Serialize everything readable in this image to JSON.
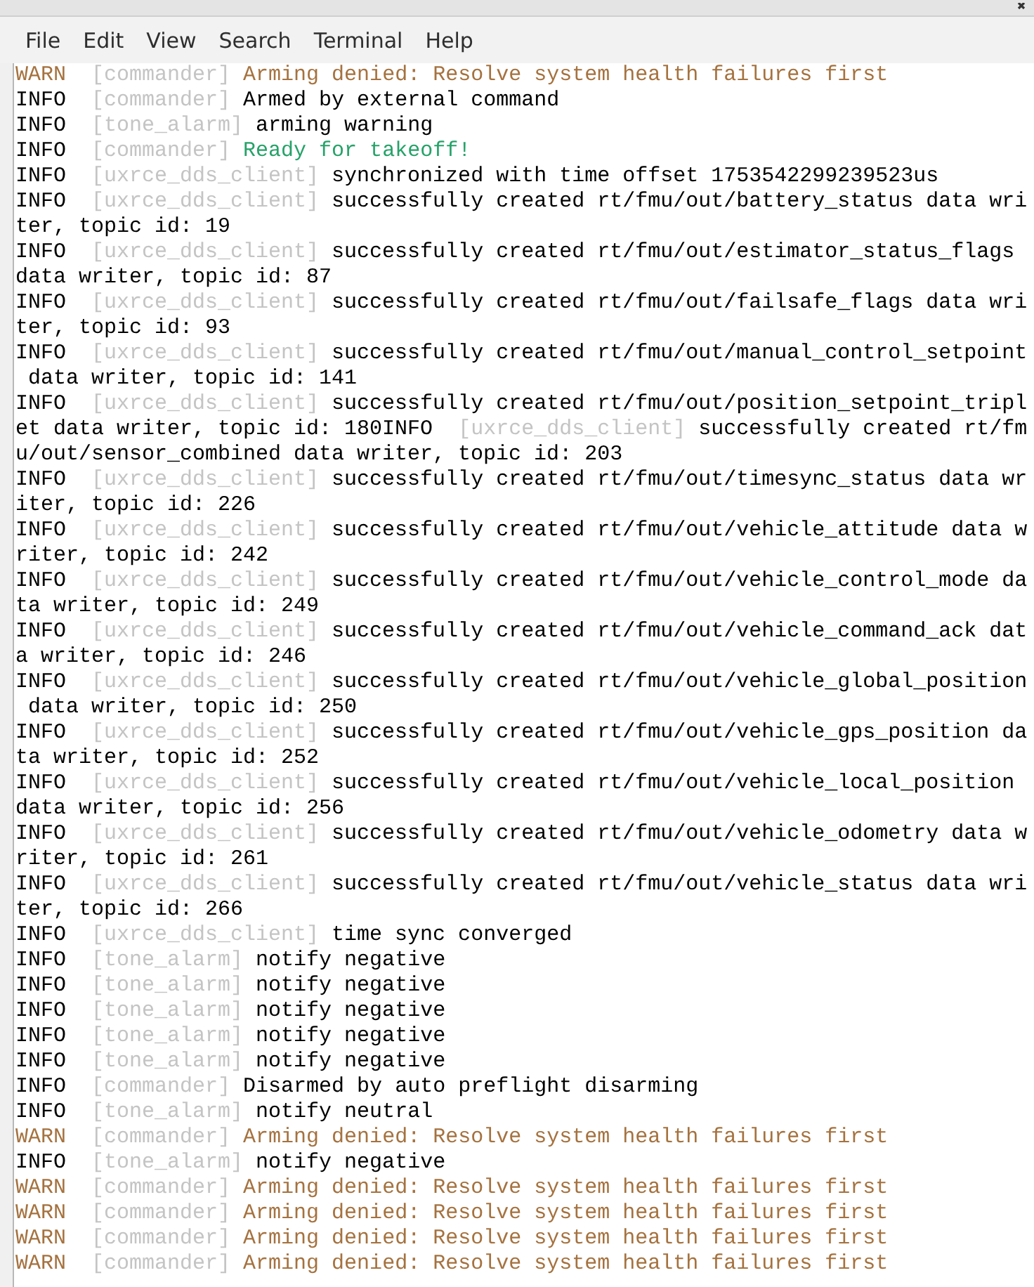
{
  "menu": [
    "File",
    "Edit",
    "View",
    "Search",
    "Terminal",
    "Help"
  ],
  "lines": [
    {
      "segments": [
        {
          "kind": "level",
          "text": "WARN",
          "color": "#a5723f"
        },
        {
          "kind": "tag",
          "text": "[commander]",
          "color": "#c4c4c4"
        },
        {
          "kind": "text",
          "text": "Arming denied: Resolve system health failures first",
          "color": "#a5723f"
        }
      ]
    },
    {
      "segments": [
        {
          "kind": "level",
          "text": "INFO",
          "color": "#000000"
        },
        {
          "kind": "tag",
          "text": "[commander]",
          "color": "#c4c4c4"
        },
        {
          "kind": "text",
          "text": "Armed by external command",
          "color": "#000000"
        }
      ]
    },
    {
      "segments": [
        {
          "kind": "level",
          "text": "INFO",
          "color": "#000000"
        },
        {
          "kind": "tag",
          "text": "[tone_alarm]",
          "color": "#c4c4c4"
        },
        {
          "kind": "text",
          "text": "arming warning",
          "color": "#000000"
        }
      ]
    },
    {
      "segments": [
        {
          "kind": "level",
          "text": "INFO",
          "color": "#000000"
        },
        {
          "kind": "tag",
          "text": "[commander]",
          "color": "#c4c4c4"
        },
        {
          "kind": "text",
          "text": "Ready for takeoff!",
          "color": "#26a269"
        }
      ]
    },
    {
      "segments": [
        {
          "kind": "level",
          "text": "INFO",
          "color": "#000000"
        },
        {
          "kind": "tag",
          "text": "[uxrce_dds_client]",
          "color": "#c4c4c4"
        },
        {
          "kind": "text",
          "text": "synchronized with time offset 1753542299239523us",
          "color": "#000000"
        }
      ]
    },
    {
      "segments": [
        {
          "kind": "level",
          "text": "INFO",
          "color": "#000000"
        },
        {
          "kind": "tag",
          "text": "[uxrce_dds_client]",
          "color": "#c4c4c4"
        },
        {
          "kind": "text",
          "text": "successfully created rt/fmu/out/battery_status data wri",
          "color": "#000000"
        }
      ]
    },
    {
      "segments": [
        {
          "kind": "text",
          "text": "ter, topic id: 19",
          "color": "#000000"
        }
      ]
    },
    {
      "segments": [
        {
          "kind": "level",
          "text": "INFO",
          "color": "#000000"
        },
        {
          "kind": "tag",
          "text": "[uxrce_dds_client]",
          "color": "#c4c4c4"
        },
        {
          "kind": "text",
          "text": "successfully created rt/fmu/out/estimator_status_flags",
          "color": "#000000"
        }
      ]
    },
    {
      "segments": [
        {
          "kind": "text",
          "text": "data writer, topic id: 87",
          "color": "#000000"
        }
      ]
    },
    {
      "segments": [
        {
          "kind": "level",
          "text": "INFO",
          "color": "#000000"
        },
        {
          "kind": "tag",
          "text": "[uxrce_dds_client]",
          "color": "#c4c4c4"
        },
        {
          "kind": "text",
          "text": "successfully created rt/fmu/out/failsafe_flags data wri",
          "color": "#000000"
        }
      ]
    },
    {
      "segments": [
        {
          "kind": "text",
          "text": "ter, topic id: 93",
          "color": "#000000"
        }
      ]
    },
    {
      "segments": [
        {
          "kind": "level",
          "text": "INFO",
          "color": "#000000"
        },
        {
          "kind": "tag",
          "text": "[uxrce_dds_client]",
          "color": "#c4c4c4"
        },
        {
          "kind": "text",
          "text": "successfully created rt/fmu/out/manual_control_setpoint",
          "color": "#000000"
        }
      ]
    },
    {
      "segments": [
        {
          "kind": "text",
          "text": " data writer, topic id: 141",
          "color": "#000000"
        }
      ]
    },
    {
      "segments": [
        {
          "kind": "level",
          "text": "INFO",
          "color": "#000000"
        },
        {
          "kind": "tag",
          "text": "[uxrce_dds_client]",
          "color": "#c4c4c4"
        },
        {
          "kind": "text",
          "text": "successfully created rt/fmu/out/position_setpoint_tripl",
          "color": "#000000"
        }
      ]
    },
    {
      "segments": [
        {
          "kind": "text",
          "text": "et data writer, topic id: 180",
          "color": "#000000"
        },
        {
          "kind": "level",
          "text": "INFO",
          "color": "#000000"
        },
        {
          "kind": "tag",
          "text": "[uxrce_dds_client]",
          "color": "#c4c4c4"
        },
        {
          "kind": "text",
          "text": "successfully created rt/fm",
          "color": "#000000"
        }
      ]
    },
    {
      "segments": [
        {
          "kind": "text",
          "text": "u/out/sensor_combined data writer, topic id: 203",
          "color": "#000000"
        }
      ]
    },
    {
      "segments": [
        {
          "kind": "level",
          "text": "INFO",
          "color": "#000000"
        },
        {
          "kind": "tag",
          "text": "[uxrce_dds_client]",
          "color": "#c4c4c4"
        },
        {
          "kind": "text",
          "text": "successfully created rt/fmu/out/timesync_status data wr",
          "color": "#000000"
        }
      ]
    },
    {
      "segments": [
        {
          "kind": "text",
          "text": "iter, topic id: 226",
          "color": "#000000"
        }
      ]
    },
    {
      "segments": [
        {
          "kind": "level",
          "text": "INFO",
          "color": "#000000"
        },
        {
          "kind": "tag",
          "text": "[uxrce_dds_client]",
          "color": "#c4c4c4"
        },
        {
          "kind": "text",
          "text": "successfully created rt/fmu/out/vehicle_attitude data w",
          "color": "#000000"
        }
      ]
    },
    {
      "segments": [
        {
          "kind": "text",
          "text": "riter, topic id: 242",
          "color": "#000000"
        }
      ]
    },
    {
      "segments": [
        {
          "kind": "level",
          "text": "INFO",
          "color": "#000000"
        },
        {
          "kind": "tag",
          "text": "[uxrce_dds_client]",
          "color": "#c4c4c4"
        },
        {
          "kind": "text",
          "text": "successfully created rt/fmu/out/vehicle_control_mode da",
          "color": "#000000"
        }
      ]
    },
    {
      "segments": [
        {
          "kind": "text",
          "text": "ta writer, topic id: 249",
          "color": "#000000"
        }
      ]
    },
    {
      "segments": [
        {
          "kind": "level",
          "text": "INFO",
          "color": "#000000"
        },
        {
          "kind": "tag",
          "text": "[uxrce_dds_client]",
          "color": "#c4c4c4"
        },
        {
          "kind": "text",
          "text": "successfully created rt/fmu/out/vehicle_command_ack dat",
          "color": "#000000"
        }
      ]
    },
    {
      "segments": [
        {
          "kind": "text",
          "text": "a writer, topic id: 246",
          "color": "#000000"
        }
      ]
    },
    {
      "segments": [
        {
          "kind": "level",
          "text": "INFO",
          "color": "#000000"
        },
        {
          "kind": "tag",
          "text": "[uxrce_dds_client]",
          "color": "#c4c4c4"
        },
        {
          "kind": "text",
          "text": "successfully created rt/fmu/out/vehicle_global_position",
          "color": "#000000"
        }
      ]
    },
    {
      "segments": [
        {
          "kind": "text",
          "text": " data writer, topic id: 250",
          "color": "#000000"
        }
      ]
    },
    {
      "segments": [
        {
          "kind": "level",
          "text": "INFO",
          "color": "#000000"
        },
        {
          "kind": "tag",
          "text": "[uxrce_dds_client]",
          "color": "#c4c4c4"
        },
        {
          "kind": "text",
          "text": "successfully created rt/fmu/out/vehicle_gps_position da",
          "color": "#000000"
        }
      ]
    },
    {
      "segments": [
        {
          "kind": "text",
          "text": "ta writer, topic id: 252",
          "color": "#000000"
        }
      ]
    },
    {
      "segments": [
        {
          "kind": "level",
          "text": "INFO",
          "color": "#000000"
        },
        {
          "kind": "tag",
          "text": "[uxrce_dds_client]",
          "color": "#c4c4c4"
        },
        {
          "kind": "text",
          "text": "successfully created rt/fmu/out/vehicle_local_position",
          "color": "#000000"
        }
      ]
    },
    {
      "segments": [
        {
          "kind": "text",
          "text": "data writer, topic id: 256",
          "color": "#000000"
        }
      ]
    },
    {
      "segments": [
        {
          "kind": "level",
          "text": "INFO",
          "color": "#000000"
        },
        {
          "kind": "tag",
          "text": "[uxrce_dds_client]",
          "color": "#c4c4c4"
        },
        {
          "kind": "text",
          "text": "successfully created rt/fmu/out/vehicle_odometry data w",
          "color": "#000000"
        }
      ]
    },
    {
      "segments": [
        {
          "kind": "text",
          "text": "riter, topic id: 261",
          "color": "#000000"
        }
      ]
    },
    {
      "segments": [
        {
          "kind": "level",
          "text": "INFO",
          "color": "#000000"
        },
        {
          "kind": "tag",
          "text": "[uxrce_dds_client]",
          "color": "#c4c4c4"
        },
        {
          "kind": "text",
          "text": "successfully created rt/fmu/out/vehicle_status data wri",
          "color": "#000000"
        }
      ]
    },
    {
      "segments": [
        {
          "kind": "text",
          "text": "ter, topic id: 266",
          "color": "#000000"
        }
      ]
    },
    {
      "segments": [
        {
          "kind": "level",
          "text": "INFO",
          "color": "#000000"
        },
        {
          "kind": "tag",
          "text": "[uxrce_dds_client]",
          "color": "#c4c4c4"
        },
        {
          "kind": "text",
          "text": "time sync converged",
          "color": "#000000"
        }
      ]
    },
    {
      "segments": [
        {
          "kind": "level",
          "text": "INFO",
          "color": "#000000"
        },
        {
          "kind": "tag",
          "text": "[tone_alarm]",
          "color": "#c4c4c4"
        },
        {
          "kind": "text",
          "text": "notify negative",
          "color": "#000000"
        }
      ]
    },
    {
      "segments": [
        {
          "kind": "level",
          "text": "INFO",
          "color": "#000000"
        },
        {
          "kind": "tag",
          "text": "[tone_alarm]",
          "color": "#c4c4c4"
        },
        {
          "kind": "text",
          "text": "notify negative",
          "color": "#000000"
        }
      ]
    },
    {
      "segments": [
        {
          "kind": "level",
          "text": "INFO",
          "color": "#000000"
        },
        {
          "kind": "tag",
          "text": "[tone_alarm]",
          "color": "#c4c4c4"
        },
        {
          "kind": "text",
          "text": "notify negative",
          "color": "#000000"
        }
      ]
    },
    {
      "segments": [
        {
          "kind": "level",
          "text": "INFO",
          "color": "#000000"
        },
        {
          "kind": "tag",
          "text": "[tone_alarm]",
          "color": "#c4c4c4"
        },
        {
          "kind": "text",
          "text": "notify negative",
          "color": "#000000"
        }
      ]
    },
    {
      "segments": [
        {
          "kind": "level",
          "text": "INFO",
          "color": "#000000"
        },
        {
          "kind": "tag",
          "text": "[tone_alarm]",
          "color": "#c4c4c4"
        },
        {
          "kind": "text",
          "text": "notify negative",
          "color": "#000000"
        }
      ]
    },
    {
      "segments": [
        {
          "kind": "level",
          "text": "INFO",
          "color": "#000000"
        },
        {
          "kind": "tag",
          "text": "[commander]",
          "color": "#c4c4c4"
        },
        {
          "kind": "text",
          "text": "Disarmed by auto preflight disarming",
          "color": "#000000"
        }
      ]
    },
    {
      "segments": [
        {
          "kind": "level",
          "text": "INFO",
          "color": "#000000"
        },
        {
          "kind": "tag",
          "text": "[tone_alarm]",
          "color": "#c4c4c4"
        },
        {
          "kind": "text",
          "text": "notify neutral",
          "color": "#000000"
        }
      ]
    },
    {
      "segments": [
        {
          "kind": "level",
          "text": "WARN",
          "color": "#a5723f"
        },
        {
          "kind": "tag",
          "text": "[commander]",
          "color": "#c4c4c4"
        },
        {
          "kind": "text",
          "text": "Arming denied: Resolve system health failures first",
          "color": "#a5723f"
        }
      ]
    },
    {
      "segments": [
        {
          "kind": "level",
          "text": "INFO",
          "color": "#000000"
        },
        {
          "kind": "tag",
          "text": "[tone_alarm]",
          "color": "#c4c4c4"
        },
        {
          "kind": "text",
          "text": "notify negative",
          "color": "#000000"
        }
      ]
    },
    {
      "segments": [
        {
          "kind": "level",
          "text": "WARN",
          "color": "#a5723f"
        },
        {
          "kind": "tag",
          "text": "[commander]",
          "color": "#c4c4c4"
        },
        {
          "kind": "text",
          "text": "Arming denied: Resolve system health failures first",
          "color": "#a5723f"
        }
      ]
    },
    {
      "segments": [
        {
          "kind": "level",
          "text": "WARN",
          "color": "#a5723f"
        },
        {
          "kind": "tag",
          "text": "[commander]",
          "color": "#c4c4c4"
        },
        {
          "kind": "text",
          "text": "Arming denied: Resolve system health failures first",
          "color": "#a5723f"
        }
      ]
    },
    {
      "segments": [
        {
          "kind": "level",
          "text": "WARN",
          "color": "#a5723f"
        },
        {
          "kind": "tag",
          "text": "[commander]",
          "color": "#c4c4c4"
        },
        {
          "kind": "text",
          "text": "Arming denied: Resolve system health failures first",
          "color": "#a5723f"
        }
      ]
    },
    {
      "segments": [
        {
          "kind": "level",
          "text": "WARN",
          "color": "#a5723f"
        },
        {
          "kind": "tag",
          "text": "[commander]",
          "color": "#c4c4c4"
        },
        {
          "kind": "text",
          "text": "Arming denied: Resolve system health failures first",
          "color": "#a5723f"
        }
      ]
    }
  ]
}
